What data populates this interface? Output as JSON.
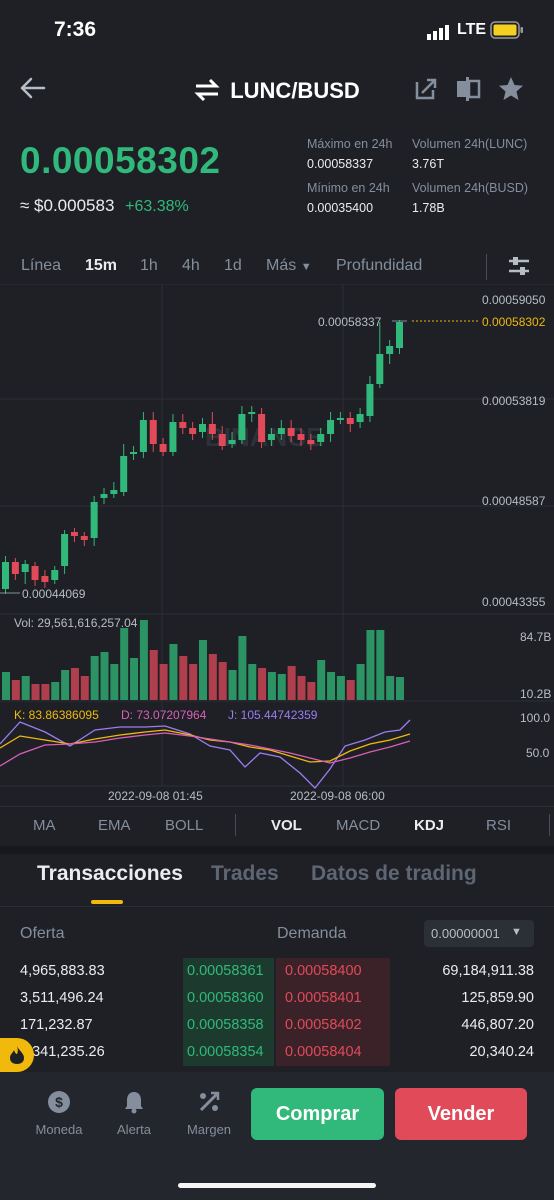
{
  "status": {
    "time": "7:36",
    "network": "LTE"
  },
  "header": {
    "pair": "LUNC/BUSD"
  },
  "price": {
    "last": "0.00058302",
    "usd": "≈ $0.000583",
    "change": "+63.38%"
  },
  "stats": {
    "high_label": "Máximo en 24h",
    "high_value": "0.00058337",
    "vol_lunc_label": "Volumen 24h(LUNC)",
    "vol_lunc_value": "3.76T",
    "low_label": "Mínimo en 24h",
    "low_value": "0.00035400",
    "vol_busd_label": "Volumen 24h(BUSD)",
    "vol_busd_value": "1.78B"
  },
  "timeframes": [
    "Línea",
    "15m",
    "1h",
    "4h",
    "1d",
    "Más",
    "Profundidad"
  ],
  "chart": {
    "price_axis": [
      "0.00059050",
      "0.00053819",
      "0.00048587",
      "0.00043355"
    ],
    "current_price_tag": "0.00058302",
    "high_label": "0.00058337",
    "low_label": "0.00044069",
    "watermark": "BINANCE",
    "vol_label": "Vol: 29,561,616,257.04",
    "vol_axis": [
      "84.7B",
      "10.2B"
    ],
    "kdj_k": "K: 83.86386095",
    "kdj_d": "D: 73.07207964",
    "kdj_j": "J: 105.44742359",
    "kdj_axis": [
      "100.0",
      "50.0"
    ],
    "time_axis": [
      "2022-09-08 01:45",
      "2022-09-08 06:00"
    ]
  },
  "indicators": [
    "MA",
    "EMA",
    "BOLL",
    "VOL",
    "MACD",
    "KDJ",
    "RSI"
  ],
  "section_tabs": [
    "Transacciones",
    "Trades",
    "Datos de trading"
  ],
  "orderbook": {
    "bid_label": "Oferta",
    "ask_label": "Demanda",
    "precision": "0.00000001",
    "rows": [
      {
        "bid_qty": "4,965,883.83",
        "bid": "0.00058361",
        "ask": "0.00058400",
        "ask_qty": "69,184,911.38"
      },
      {
        "bid_qty": "3,511,496.24",
        "bid": "0.00058360",
        "ask": "0.00058401",
        "ask_qty": "125,859.90"
      },
      {
        "bid_qty": "171,232.87",
        "bid": "0.00058358",
        "ask": "0.00058402",
        "ask_qty": "446,807.20"
      },
      {
        "bid_qty": "1,341,235.26",
        "bid": "0.00058354",
        "ask": "0.00058404",
        "ask_qty": "20,340.24"
      }
    ]
  },
  "nav": {
    "moneda": "Moneda",
    "alerta": "Alerta",
    "margen": "Margen",
    "buy": "Comprar",
    "sell": "Vender"
  },
  "colors": {
    "up": "#30b97a",
    "down": "#e04a59",
    "accent": "#f0b90b",
    "bg": "#1e2026"
  }
}
